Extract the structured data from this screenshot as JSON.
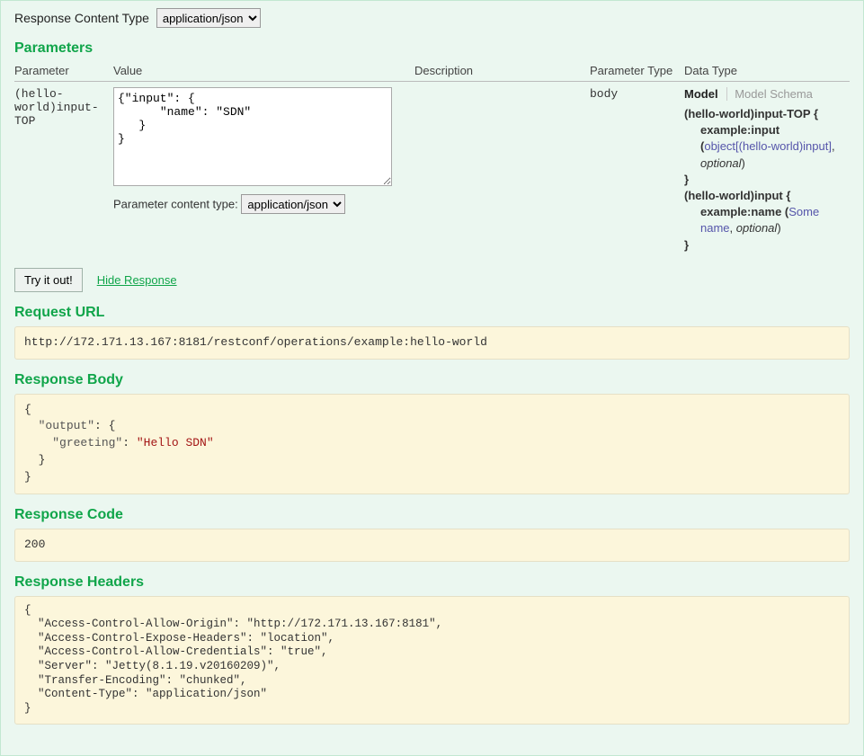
{
  "contentType": {
    "label": "Response Content Type",
    "value": "application/json"
  },
  "parameters": {
    "heading": "Parameters",
    "headers": {
      "parameter": "Parameter",
      "value": "Value",
      "description": "Description",
      "paramType": "Parameter Type",
      "dataType": "Data Type"
    },
    "row": {
      "name": "(hello-world)input-TOP",
      "body": "{\"input\": {\n      \"name\": \"SDN\"\n   }\n}",
      "parameterContentTypeLabel": "Parameter content type:",
      "parameterContentTypeValue": "application/json",
      "description": "",
      "type": "body"
    },
    "dataType": {
      "tabModel": "Model",
      "tabSchema": "Model Schema",
      "line1a": "(hello-world)input-TOP {",
      "line2a": "example:input (",
      "line2b": "object[(hello-world)input]",
      "line2c": ", ",
      "line2d": "optional",
      "line2e": ")",
      "line3a": "}",
      "line4a": "(hello-world)input {",
      "line5a": "example:name (",
      "line5b": "Some name",
      "line5c": ", ",
      "line5d": "optional",
      "line5e": ")",
      "line6a": "}"
    }
  },
  "actions": {
    "tryItOut": "Try it out!",
    "hideResponse": "Hide Response"
  },
  "requestUrl": {
    "heading": "Request URL",
    "value": "http://172.171.13.167:8181/restconf/operations/example:hello-world"
  },
  "responseBody": {
    "heading": "Response Body",
    "b0": "{",
    "k1": "\"output\"",
    "c1": ": {",
    "k2": "\"greeting\"",
    "c2": ": ",
    "v2": "\"Hello SDN\"",
    "b3": "  }",
    "b4": "}"
  },
  "responseCode": {
    "heading": "Response Code",
    "value": "200"
  },
  "responseHeaders": {
    "heading": "Response Headers",
    "text": "{\n  \"Access-Control-Allow-Origin\": \"http://172.171.13.167:8181\",\n  \"Access-Control-Expose-Headers\": \"location\",\n  \"Access-Control-Allow-Credentials\": \"true\",\n  \"Server\": \"Jetty(8.1.19.v20160209)\",\n  \"Transfer-Encoding\": \"chunked\",\n  \"Content-Type\": \"application/json\"\n}"
  }
}
